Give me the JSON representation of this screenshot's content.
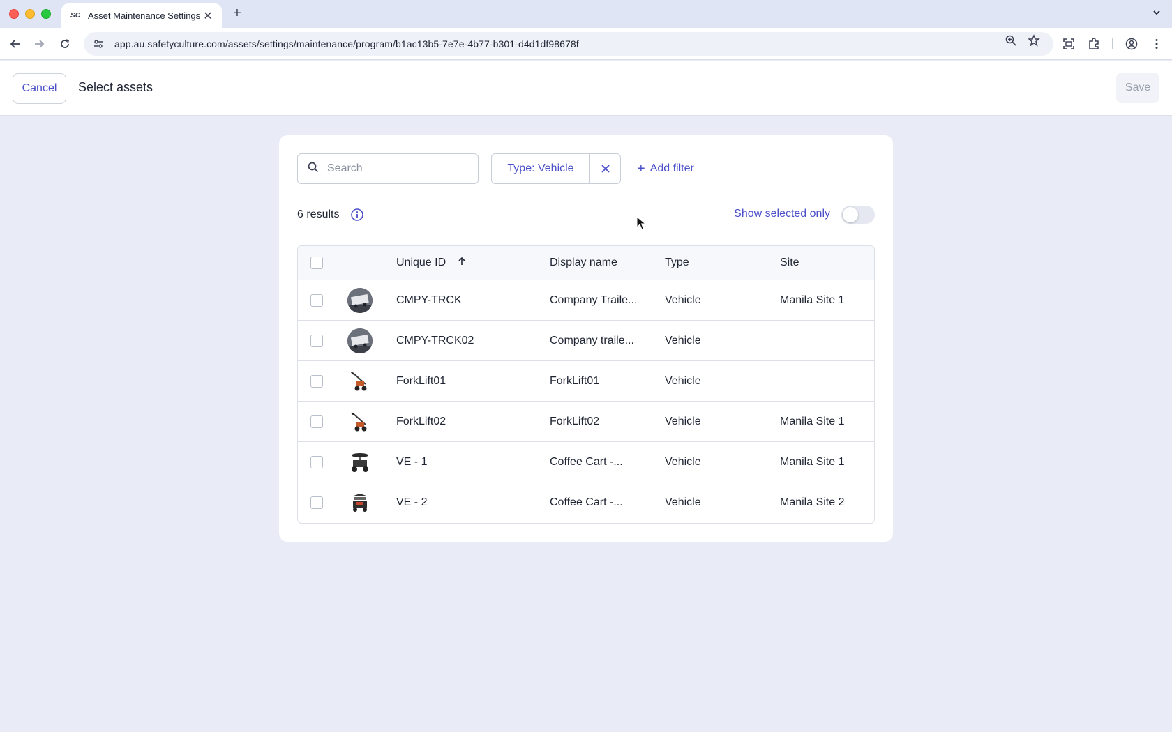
{
  "browser": {
    "tab_title": "Asset Maintenance Settings |",
    "favicon_text": "SC",
    "url": "app.au.safetyculture.com/assets/settings/maintenance/program/b1ac13b5-7e7e-4b77-b301-d4d1df98678f",
    "icons": [
      "back-icon",
      "forward-icon",
      "reload-icon",
      "site-settings-icon",
      "zoom-icon",
      "bookmark-star-icon",
      "screenshot-icon",
      "extensions-icon",
      "profile-icon",
      "more-menu-icon"
    ]
  },
  "header": {
    "cancel_label": "Cancel",
    "title": "Select assets",
    "save_label": "Save"
  },
  "toolbar": {
    "search_placeholder": "Search",
    "filter_label": "Type: Vehicle",
    "add_filter_label": "Add filter",
    "results_text": "6 results",
    "show_selected_label": "Show selected only",
    "show_selected_on": false
  },
  "table": {
    "columns": {
      "unique_id": "Unique ID",
      "display_name": "Display name",
      "type": "Type",
      "site": "Site"
    },
    "sort_column": "Unique ID",
    "sort_direction": "ascending",
    "rows": [
      {
        "unique_id": "CMPY-TRCK",
        "display_name": "Company Traile...",
        "type": "Vehicle",
        "site": "Manila Site 1",
        "thumb": "trailer-icon"
      },
      {
        "unique_id": "CMPY-TRCK02",
        "display_name": "Company traile...",
        "type": "Vehicle",
        "site": "",
        "thumb": "trailer-icon"
      },
      {
        "unique_id": "ForkLift01",
        "display_name": "ForkLift01",
        "type": "Vehicle",
        "site": "",
        "thumb": "forklift-icon"
      },
      {
        "unique_id": "ForkLift02",
        "display_name": "ForkLift02",
        "type": "Vehicle",
        "site": "Manila Site 1",
        "thumb": "forklift-icon"
      },
      {
        "unique_id": "VE - 1",
        "display_name": "Coffee Cart -...",
        "type": "Vehicle",
        "site": "Manila Site 1",
        "thumb": "coffee-cart-icon"
      },
      {
        "unique_id": "VE - 2",
        "display_name": "Coffee Cart -...",
        "type": "Vehicle",
        "site": "Manila Site 2",
        "thumb": "coffee-cart-icon"
      }
    ]
  },
  "colors": {
    "accent": "#4b4fc9",
    "page_background": "#e9ecf6",
    "text": "#1f2533"
  }
}
